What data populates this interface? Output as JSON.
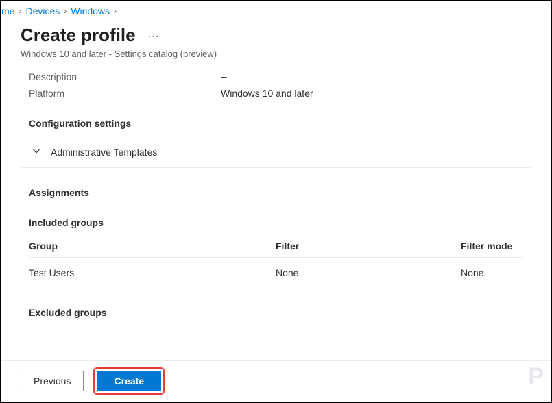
{
  "breadcrumb": {
    "items": [
      "me",
      "Devices",
      "Windows"
    ]
  },
  "header": {
    "title": "Create profile",
    "subtitle": "Windows 10 and later - Settings catalog (preview)"
  },
  "details": {
    "rows": [
      {
        "label": "Description",
        "value": "--"
      },
      {
        "label": "Platform",
        "value": "Windows 10 and later"
      }
    ]
  },
  "sections": {
    "config_heading": "Configuration settings",
    "config_group": "Administrative Templates",
    "assignments_heading": "Assignments",
    "included_heading": "Included groups",
    "excluded_heading": "Excluded groups"
  },
  "table": {
    "headers": {
      "group": "Group",
      "filter": "Filter",
      "mode": "Filter mode"
    },
    "rows": [
      {
        "group": "Test Users",
        "filter": "None",
        "mode": "None"
      }
    ]
  },
  "footer": {
    "previous": "Previous",
    "create": "Create"
  },
  "watermark": "P"
}
